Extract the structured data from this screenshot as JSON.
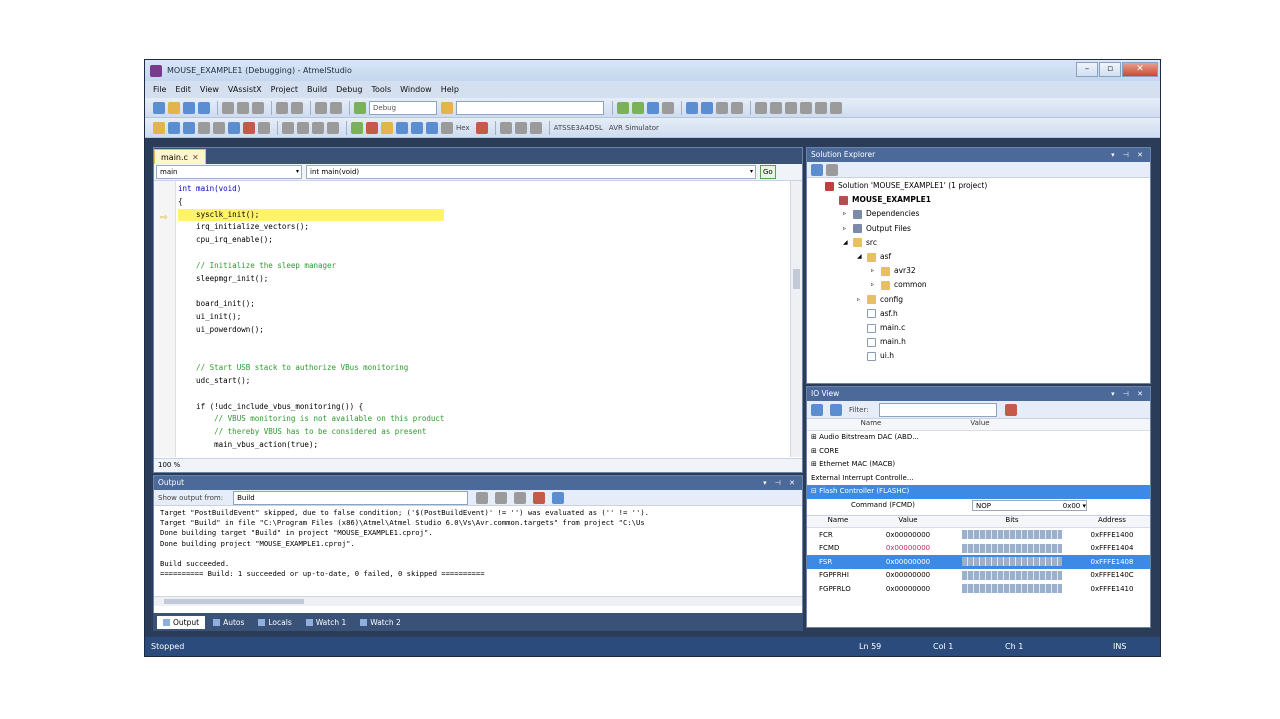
{
  "window": {
    "title": "MOUSE_EXAMPLE1 (Debugging) - AtmelStudio",
    "buttons": [
      "–",
      "▫",
      "✕"
    ]
  },
  "menu": [
    "File",
    "Edit",
    "View",
    "VAssistX",
    "Project",
    "Build",
    "Debug",
    "Tools",
    "Window",
    "Help"
  ],
  "toolbar": {
    "config": "Debug",
    "hex": "Hex",
    "tool1": "ATSSE3A4DSL",
    "tool2": "AVR Simulator"
  },
  "editor": {
    "tab": "main.c",
    "nav_left": "main",
    "nav_right": "int main(void)",
    "go": "Go",
    "zoom": "100 %",
    "code": [
      {
        "t": "int main(void)",
        "c": "kw"
      },
      {
        "t": "{",
        "c": ""
      },
      {
        "t": "    sysclk_init();",
        "c": "hl"
      },
      {
        "t": "    irq_initialize_vectors();",
        "c": ""
      },
      {
        "t": "    cpu_irq_enable();",
        "c": ""
      },
      {
        "t": "",
        "c": ""
      },
      {
        "t": "    // Initialize the sleep manager",
        "c": "cm"
      },
      {
        "t": "    sleepmgr_init();",
        "c": ""
      },
      {
        "t": "",
        "c": ""
      },
      {
        "t": "    board_init();",
        "c": ""
      },
      {
        "t": "    ui_init();",
        "c": ""
      },
      {
        "t": "    ui_powerdown();",
        "c": ""
      },
      {
        "t": "",
        "c": ""
      },
      {
        "t": "",
        "c": ""
      },
      {
        "t": "    // Start USB stack to authorize VBus monitoring",
        "c": "cm"
      },
      {
        "t": "    udc_start();",
        "c": ""
      },
      {
        "t": "",
        "c": ""
      },
      {
        "t": "    if (!udc_include_vbus_monitoring()) {",
        "c": ""
      },
      {
        "t": "        // VBUS monitoring is not available on this product",
        "c": "cm"
      },
      {
        "t": "        // thereby VBUS has to be considered as present",
        "c": "cm"
      },
      {
        "t": "        main_vbus_action(true);",
        "c": ""
      }
    ]
  },
  "solution_explorer": {
    "title": "Solution Explorer",
    "items": [
      {
        "label": "Solution 'MOUSE_EXAMPLE1' (1 project)",
        "indent": 0,
        "icon": "sol"
      },
      {
        "label": "MOUSE_EXAMPLE1",
        "indent": 1,
        "icon": "proj",
        "bold": true
      },
      {
        "label": "Dependencies",
        "indent": 2,
        "icon": "dep",
        "arrow": "▹"
      },
      {
        "label": "Output Files",
        "indent": 2,
        "icon": "dep",
        "arrow": "▹"
      },
      {
        "label": "src",
        "indent": 2,
        "icon": "fold",
        "arrow": "◢"
      },
      {
        "label": "asf",
        "indent": 3,
        "icon": "fold",
        "arrow": "◢"
      },
      {
        "label": "avr32",
        "indent": 4,
        "icon": "fold",
        "arrow": "▹"
      },
      {
        "label": "common",
        "indent": 4,
        "icon": "fold",
        "arrow": "▹"
      },
      {
        "label": "config",
        "indent": 3,
        "icon": "fold",
        "arrow": "▹"
      },
      {
        "label": "asf.h",
        "indent": 3,
        "icon": "file"
      },
      {
        "label": "main.c",
        "indent": 3,
        "icon": "file"
      },
      {
        "label": "main.h",
        "indent": 3,
        "icon": "file"
      },
      {
        "label": "ui.h",
        "indent": 3,
        "icon": "file"
      }
    ]
  },
  "io_view": {
    "title": "IO View",
    "filter_label": "Filter:",
    "col_name": "Name",
    "col_value": "Value",
    "peripherals": [
      {
        "label": "⊞ Audio Bitstream DAC (ABD...",
        "sel": false
      },
      {
        "label": "⊞ CORE",
        "sel": false
      },
      {
        "label": "⊞ Ethernet MAC (MACB)",
        "sel": false
      },
      {
        "label": "   External Interrupt Controlle...",
        "sel": false
      },
      {
        "label": "⊟ Flash Controller (FLASHC)",
        "sel": true
      }
    ],
    "command_label": "Command (FCMD)",
    "command_value": "NOP",
    "command_num": "0x00",
    "reg_headers": {
      "name": "Name",
      "value": "Value",
      "bits": "Bits",
      "address": "Address"
    },
    "registers": [
      {
        "name": "FCR",
        "value": "0x00000000",
        "address": "0xFFFE1400",
        "sel": false
      },
      {
        "name": "FCMD",
        "value": "0x00000000",
        "address": "0xFFFE1404",
        "sel": false
      },
      {
        "name": "FSR",
        "value": "0x00000000",
        "address": "0xFFFE1408",
        "sel": true
      },
      {
        "name": "FGPFRHI",
        "value": "0x00000000",
        "address": "0xFFFE140C",
        "sel": false
      },
      {
        "name": "FGPFRLO",
        "value": "0x00000000",
        "address": "0xFFFE1410",
        "sel": false
      }
    ]
  },
  "output": {
    "title": "Output",
    "show_from_label": "Show output from:",
    "show_from_value": "Build",
    "lines": [
      "Target \"PostBuildEvent\" skipped, due to false condition; ('$(PostBuildEvent)' != '') was evaluated as ('' != '').",
      "Target \"Build\" in file \"C:\\Program Files (x86)\\Atmel\\Atmel Studio 6.0\\Vs\\Avr.common.targets\" from project \"C:\\Us",
      "Done building target \"Build\" in project \"MOUSE_EXAMPLE1.cproj\".",
      "Done building project \"MOUSE_EXAMPLE1.cproj\".",
      "",
      "Build succeeded.",
      "========== Build: 1 succeeded or up-to-date, 0 failed, 0 skipped =========="
    ]
  },
  "bottom_tabs": [
    "Output",
    "Autos",
    "Locals",
    "Watch 1",
    "Watch 2"
  ],
  "status": {
    "state": "Stopped",
    "ln": "Ln 59",
    "col": "Col 1",
    "ch": "Ch 1",
    "ins": "INS"
  }
}
